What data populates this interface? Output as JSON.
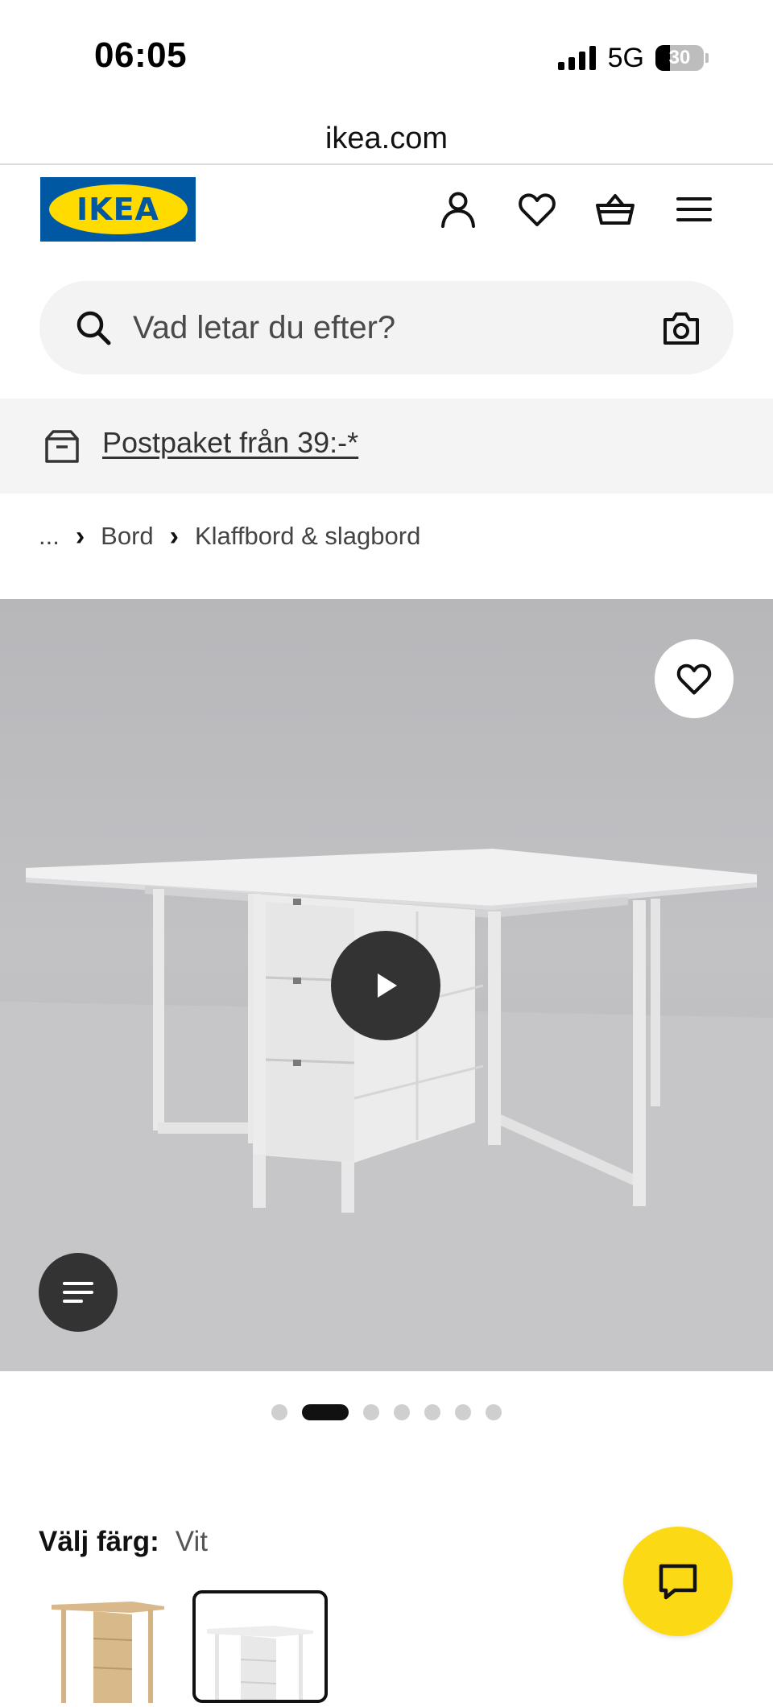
{
  "status_bar": {
    "time": "06:05",
    "network": "5G",
    "battery": "30",
    "battery_fraction": 0.3
  },
  "browser": {
    "url": "ikea.com"
  },
  "header": {
    "logo_text": "IKEA",
    "icons": [
      "user-icon",
      "heart-icon",
      "basket-icon",
      "hamburger-menu-icon"
    ]
  },
  "search": {
    "placeholder": "Vad letar du efter?"
  },
  "banner": {
    "link_text": "Postpaket från 39:-*"
  },
  "breadcrumb": {
    "items": [
      "...",
      "Bord",
      "Klaffbord & slagbord"
    ]
  },
  "gallery": {
    "total_images": 7,
    "active_index": 1
  },
  "product": {
    "color_label": "Välj färg:",
    "color_value": "Vit",
    "variants": [
      "birch",
      "white"
    ]
  },
  "colors": {
    "ikea_blue": "#0058a3",
    "ikea_yellow": "#ffdb00",
    "chat_yellow": "#fbd914"
  }
}
